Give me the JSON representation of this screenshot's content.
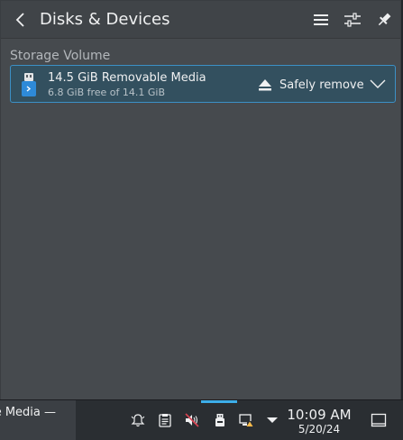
{
  "popup": {
    "title": "Disks & Devices",
    "section_label": "Storage Volume",
    "device": {
      "name": "14.5 GiB Removable Media",
      "free_space": "6.8 GiB free of 14.1 GiB",
      "action_label": "Safely remove",
      "icon": "usb-drive-icon"
    },
    "header_icons": [
      "back-icon",
      "menu-icon",
      "configure-icon",
      "pin-icon"
    ]
  },
  "taskbar": {
    "task_text": "e Media —",
    "clock": {
      "time": "10:09 AM",
      "date": "5/20/24"
    },
    "tray_icons": [
      "notifications-icon",
      "clipboard-icon",
      "volume-muted-icon",
      "removable-device-icon",
      "network-icon",
      "expand-tray-icon",
      "show-desktop-icon"
    ]
  },
  "colors": {
    "accent": "#3daee9",
    "popup_bg": "#464a4e",
    "selected_item_bg": "#33505f",
    "panel_bg": "#2a2e32"
  }
}
